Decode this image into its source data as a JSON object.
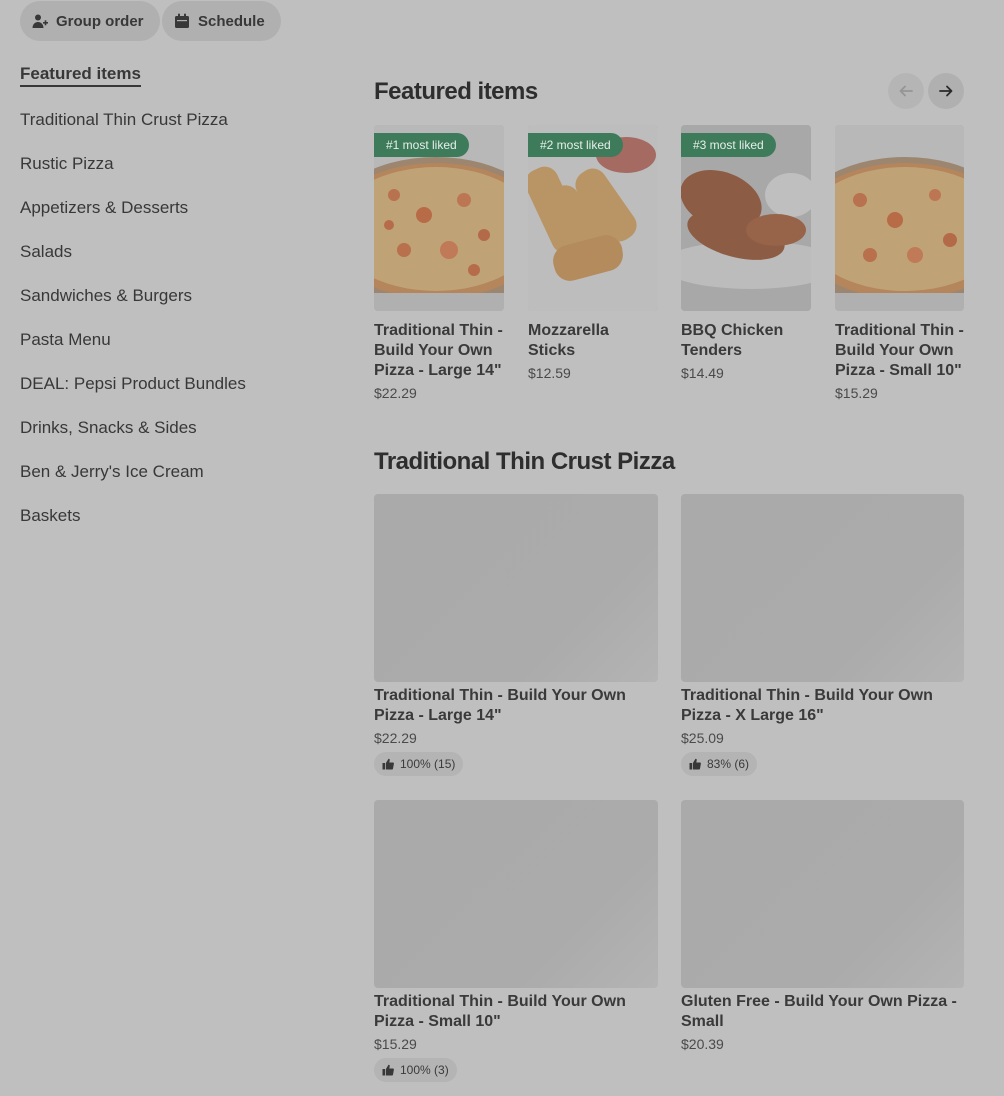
{
  "header": {
    "group_order_label": "Group order",
    "schedule_label": "Schedule"
  },
  "sidebar": {
    "items": [
      {
        "label": "Featured items",
        "active": true
      },
      {
        "label": "Traditional Thin Crust Pizza"
      },
      {
        "label": "Rustic Pizza"
      },
      {
        "label": "Appetizers & Desserts"
      },
      {
        "label": "Salads"
      },
      {
        "label": "Sandwiches & Burgers"
      },
      {
        "label": "Pasta Menu"
      },
      {
        "label": "DEAL: Pepsi Product Bundles"
      },
      {
        "label": "Drinks, Snacks & Sides"
      },
      {
        "label": "Ben & Jerry's Ice Cream"
      },
      {
        "label": "Baskets"
      }
    ]
  },
  "featured": {
    "title": "Featured items",
    "items": [
      {
        "badge": "#1 most liked",
        "name": "Traditional Thin - Build Your Own Pizza - Large 14\"",
        "price": "$22.29"
      },
      {
        "badge": "#2 most liked",
        "name": "Mozzarella Sticks",
        "price": "$12.59"
      },
      {
        "badge": "#3 most liked",
        "name": "BBQ Chicken Tenders",
        "price": "$14.49"
      },
      {
        "badge": "",
        "name": "Traditional Thin - Build Your Own Pizza - Small 10\"",
        "price": "$15.29"
      }
    ]
  },
  "thin_crust": {
    "title": "Traditional Thin Crust Pizza",
    "items": [
      {
        "name": "Traditional Thin - Build Your Own Pizza - Large 14\"",
        "price": "$22.29",
        "rating": "100% (15)"
      },
      {
        "name": "Traditional Thin - Build Your Own Pizza - X Large 16\"",
        "price": "$25.09",
        "rating": "83% (6)"
      },
      {
        "name": "Traditional Thin - Build Your Own Pizza - Small 10\"",
        "price": "$15.29",
        "rating": "100% (3)"
      },
      {
        "name": "Gluten Free -  Build Your Own Pizza - Small",
        "price": "$20.39",
        "rating": ""
      }
    ]
  },
  "icons": [
    "add-person-icon",
    "calendar-icon",
    "arrow-left-icon",
    "arrow-right-icon",
    "thumbs-up-icon"
  ]
}
